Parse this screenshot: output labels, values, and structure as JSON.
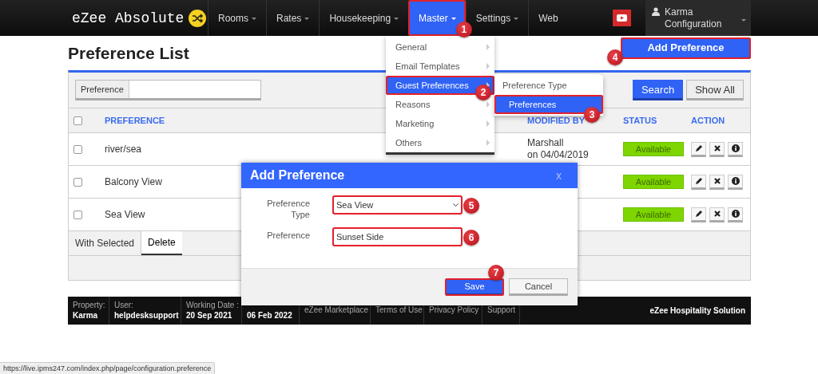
{
  "navbar": {
    "logo": "eZee Absolute",
    "items": [
      {
        "label": "Rooms",
        "dropdown": true,
        "selected": false
      },
      {
        "label": "Rates",
        "dropdown": true,
        "selected": false
      },
      {
        "label": "Housekeeping",
        "dropdown": true,
        "selected": false
      },
      {
        "label": "Master",
        "dropdown": true,
        "selected": true,
        "step": "1"
      },
      {
        "label": "Settings",
        "dropdown": true,
        "selected": false
      },
      {
        "label": "Web",
        "dropdown": false,
        "selected": false
      }
    ],
    "user": {
      "name": "Karma",
      "role": "Configuration"
    }
  },
  "master_menu": {
    "items": [
      {
        "label": "General",
        "selected": false
      },
      {
        "label": "Email Templates",
        "selected": false
      },
      {
        "label": "Guest Preferences",
        "selected": true,
        "step": "2"
      },
      {
        "label": "Reasons",
        "selected": false
      },
      {
        "label": "Marketing",
        "selected": false
      },
      {
        "label": "Others",
        "selected": false
      }
    ],
    "submenu": [
      {
        "label": "Preference Type",
        "selected": false
      },
      {
        "label": "Preferences",
        "selected": true,
        "step": "3"
      }
    ]
  },
  "page": {
    "title": "Preference List",
    "add_button": {
      "label": "Add Preference",
      "step": "4"
    }
  },
  "search": {
    "label": "Preference",
    "buttons": [
      {
        "label": "Search",
        "primary": true
      },
      {
        "label": "Show All",
        "primary": false
      }
    ]
  },
  "table": {
    "all_checked": false,
    "columns": [
      "PREFERENCE",
      "MODIFIED BY",
      "STATUS",
      "ACTION"
    ],
    "rows": [
      {
        "checked": false,
        "preference": "river/sea",
        "modified_by": "Marshall",
        "modified_on": "on 04/04/2019",
        "status": "Available"
      },
      {
        "checked": false,
        "preference": "Balcony View",
        "status": "Available"
      },
      {
        "checked": false,
        "preference": "Sea View",
        "status": "Available"
      }
    ]
  },
  "bulk": {
    "label": "With Selected",
    "action": "Delete"
  },
  "footer": {
    "fields": [
      {
        "label": "Property:",
        "value": "Karma"
      },
      {
        "label": "User:",
        "value": "helpdesksupport"
      },
      {
        "label": "Working Date :",
        "value": "20 Sep 2021"
      },
      {
        "value": "06 Feb 2022"
      }
    ],
    "links": [
      "eZee Marketplace",
      "Terms of Use",
      "Privacy Policy",
      "Support"
    ],
    "brand": "eZee Hospitality Solution"
  },
  "dialog": {
    "title": "Add Preference",
    "close": "x",
    "fields": [
      {
        "kind": "select",
        "label": "Preference Type",
        "value": "Sea View",
        "step": "5"
      },
      {
        "kind": "input",
        "label": "Preference",
        "value": "Sunset Side",
        "step": "6"
      }
    ],
    "buttons": [
      {
        "label": "Save",
        "primary": true,
        "step": "7"
      },
      {
        "label": "Cancel",
        "primary": false
      }
    ]
  },
  "status_url": "https://live.ipms247.com/index.php/page/configuration.preference"
}
